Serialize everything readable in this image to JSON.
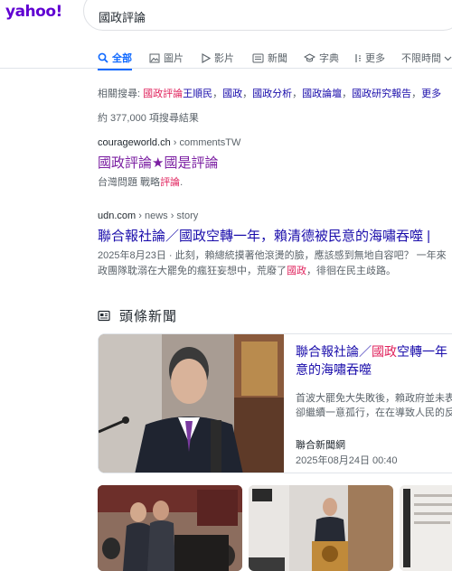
{
  "header": {
    "logo": "yahoo",
    "logo_bang": "!",
    "query": "國政評論"
  },
  "tabs": [
    {
      "label": "全部",
      "icon": "search-icon",
      "active": true
    },
    {
      "label": "圖片",
      "icon": "image-icon"
    },
    {
      "label": "影片",
      "icon": "play-icon"
    },
    {
      "label": "新聞",
      "icon": "news-icon"
    },
    {
      "label": "字典",
      "icon": "graduation-cap-icon"
    },
    {
      "label": "更多",
      "icon": "more-icon"
    },
    {
      "label": "不限時間",
      "icon": "chevron-down-icon"
    }
  ],
  "related": {
    "prefix": "相關搜尋:",
    "items": [
      {
        "highlight": "國政評論",
        "rest": "王順民"
      },
      {
        "highlight": "",
        "rest": "國政"
      },
      {
        "highlight": "",
        "rest": "國政分析"
      },
      {
        "highlight": "",
        "rest": "國政論壇"
      },
      {
        "highlight": "",
        "rest": "國政研究報告"
      },
      {
        "highlight": "",
        "rest": "更多"
      }
    ]
  },
  "result_count": "約 377,000 項搜尋結果",
  "results": [
    {
      "domain": "courageworld.ch",
      "path": " › commentsTW",
      "title": "國政評論★國是評論",
      "snippet_a": "台灣問題 戰略",
      "snippet_hl": "評論",
      "snippet_b": "."
    },
    {
      "domain": "udn.com",
      "path": " › news › story",
      "title": "聯合報社論／國政空轉一年，賴清德被民意的海嘯吞噬 |",
      "snippet_line1": "2025年8月23日 · 此刻，賴總統摸著他滾燙的臉，應該感到無地自容吧？ 一年來",
      "snippet_line2_a": "政團隊耽溺在大罷免的瘋狂妄想中，荒廢了",
      "snippet_line2_hl": "國政",
      "snippet_line2_b": "，徘徊在民主歧路。"
    }
  ],
  "top_news": {
    "heading": "頭條新聞",
    "card": {
      "title_a": "聯合報社論／",
      "title_hl": "國政",
      "title_b": "空轉一年",
      "title_line2": "意的海嘯吞噬",
      "snippet_line1": "首波大罷免大失敗後，賴政府並未表",
      "snippet_line2": "卻繼續一意孤行，在在導致人民的反",
      "source": "聯合新聞網",
      "time": "2025年08月24日 00:40"
    }
  }
}
